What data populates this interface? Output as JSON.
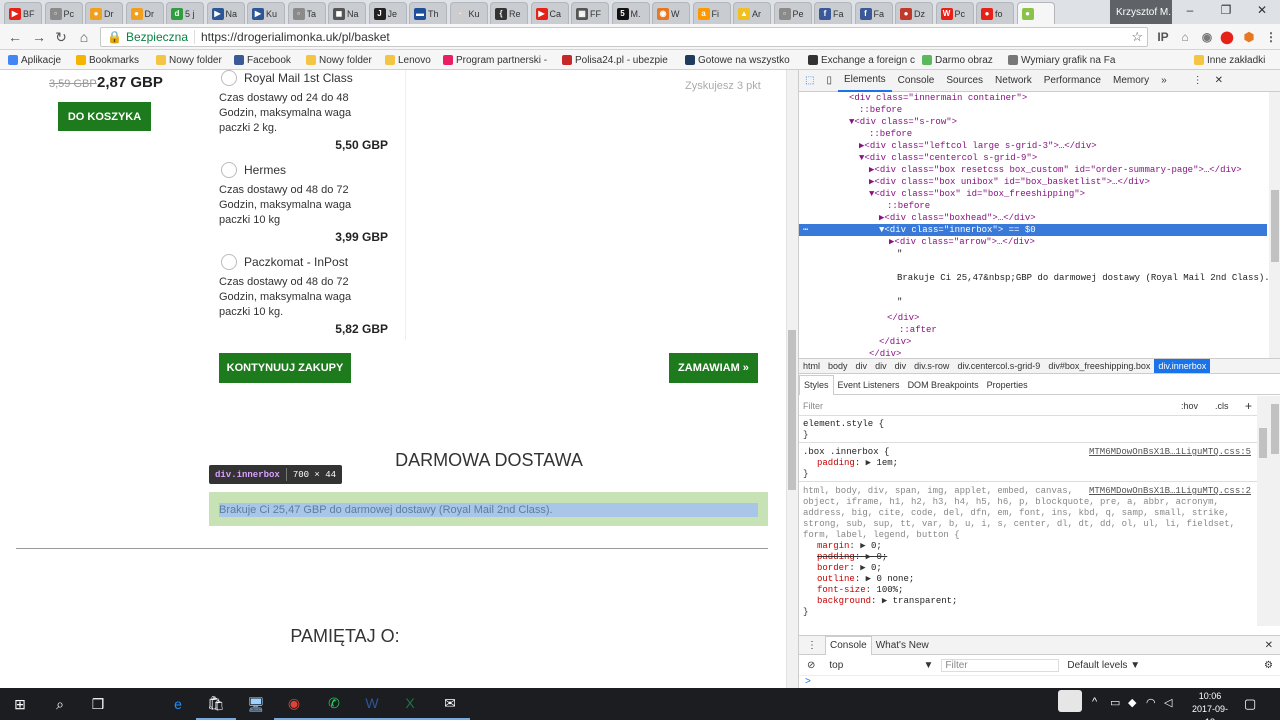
{
  "browser": {
    "tabs": [
      {
        "label": "BF",
        "color": "#e62117",
        "glyph": "▶"
      },
      {
        "label": "Pc",
        "color": "#8a8a8a",
        "glyph": "▫"
      },
      {
        "label": "Dr",
        "color": "#f0a020",
        "glyph": "●"
      },
      {
        "label": "Dr",
        "color": "#f0a020",
        "glyph": "●"
      },
      {
        "label": "5 j",
        "color": "#2e9e3e",
        "glyph": "d"
      },
      {
        "label": "Na",
        "color": "#2b5797",
        "glyph": "▶"
      },
      {
        "label": "Ku",
        "color": "#2b5797",
        "glyph": "▶"
      },
      {
        "label": "Ta",
        "color": "#8a8a8a",
        "glyph": "▫"
      },
      {
        "label": "Na",
        "color": "#555555",
        "glyph": "◼"
      },
      {
        "label": "Je",
        "color": "#222222",
        "glyph": "J"
      },
      {
        "label": "Th",
        "color": "#1f4e9c",
        "glyph": "▬"
      },
      {
        "label": "Ku",
        "color": "#cccccc",
        "glyph": "·"
      },
      {
        "label": "Re",
        "color": "#333333",
        "glyph": "{"
      },
      {
        "label": "Ca",
        "color": "#e62117",
        "glyph": "▶"
      },
      {
        "label": "FF",
        "color": "#555555",
        "glyph": "▦"
      },
      {
        "label": "M.",
        "color": "#111111",
        "glyph": "5"
      },
      {
        "label": "W",
        "color": "#e87722",
        "glyph": "◉"
      },
      {
        "label": "Fi",
        "color": "#ff9900",
        "glyph": "a"
      },
      {
        "label": "Ar",
        "color": "#f0c020",
        "glyph": "▲"
      },
      {
        "label": "Pe",
        "color": "#8a8a8a",
        "glyph": "▫"
      },
      {
        "label": "Fa",
        "color": "#3b5998",
        "glyph": "f"
      },
      {
        "label": "Fa",
        "color": "#3b5998",
        "glyph": "f"
      },
      {
        "label": "Dz",
        "color": "#c0392b",
        "glyph": "●"
      },
      {
        "label": "Pc",
        "color": "#e62117",
        "glyph": "W"
      },
      {
        "label": "fo",
        "color": "#e62117",
        "glyph": "●"
      },
      {
        "label": "",
        "color": "#8bc34a",
        "glyph": "●"
      }
    ],
    "profile_name": "Krzysztof M.",
    "window_buttons": [
      "–",
      "❐",
      "✕"
    ],
    "secure_label": "Bezpieczna",
    "url": "https://drogerialimonka.uk/pl/basket",
    "extensions": [
      "IP",
      "⌂",
      "◉",
      "⬤",
      "⬢"
    ],
    "bookmarks": [
      {
        "label": "Aplikacje",
        "color": "#4285f4"
      },
      {
        "label": "Bookmarks",
        "color": "#f4b400"
      },
      {
        "label": "Nowy folder",
        "color": "#f4c542"
      },
      {
        "label": "Facebook",
        "color": "#3b5998"
      },
      {
        "label": "Nowy folder",
        "color": "#f4c542"
      },
      {
        "label": "Lenovo",
        "color": "#f4c542"
      },
      {
        "label": "Program partnerski -",
        "color": "#e91e63"
      },
      {
        "label": "Polisa24.pl - ubezpie",
        "color": "#c62828"
      },
      {
        "label": "Gotowe na wszystko",
        "color": "#1e3a5f"
      },
      {
        "label": "Exchange a foreign c",
        "color": "#333333"
      },
      {
        "label": "Darmo obraz",
        "color": "#5cb85c"
      },
      {
        "label": "Wymiary grafik na Fa",
        "color": "#777777"
      },
      {
        "label": "Inne zakładki",
        "color": "#f4c542"
      }
    ]
  },
  "page": {
    "old_price": "3,59 GBP",
    "price": "2,87 GBP",
    "add_to_cart": "DO KOSZYKA",
    "points_text": "Zyskujesz 3 pkt",
    "shipping": [
      {
        "name": "Royal Mail 1st Class",
        "desc": [
          "Czas dostawy od 24 do 48",
          "Godzin, maksymalna waga",
          "paczki 2 kg."
        ],
        "price": "5,50 GBP"
      },
      {
        "name": "Hermes",
        "desc": [
          "Czas dostawy od 48 do 72",
          "Godzin, maksymalna waga",
          "paczki 10 kg"
        ],
        "price": "3,99 GBP"
      },
      {
        "name": "Paczkomat - InPost",
        "desc": [
          "Czas dostawy od 48 do 72",
          "Godzin, maksymalna waga",
          "paczki 10 kg."
        ],
        "price": "5,82 GBP"
      }
    ],
    "continue_button": "KONTYNUUJ ZAKUPY",
    "order_button": "ZAMAWIAM »",
    "free_delivery_title": "DARMOWA DOSTAWA",
    "free_delivery_text": "Brakuje Ci 25,47 GBP do darmowej dostawy (Royal Mail 2nd Class).",
    "inspect_tooltip": {
      "name": "div.innerbox",
      "size": "700 × 44"
    },
    "remember_title": "PAMIĘTAJ O:"
  },
  "devtools": {
    "tabs": [
      "Elements",
      "Console",
      "Sources",
      "Network",
      "Performance",
      "Memory",
      "»"
    ],
    "dom_lines": [
      "<div class=\"innermain container\">",
      "::before",
      "▼<div class=\"s-row\">",
      "::before",
      "▶<div class=\"leftcol large s-grid-3\">…</div>",
      "▼<div class=\"centercol s-grid-9\">",
      "▶<div class=\"box resetcss box_custom\" id=\"order-summary-page\">…</div>",
      "▶<div class=\"box unibox\" id=\"box_basketlist\">…</div>",
      "▼<div class=\"box\" id=\"box_freeshipping\">",
      "::before",
      "▶<div class=\"boxhead\">…</div>",
      "▼<div class=\"innerbox\"> == $0",
      "▶<div class=\"arrow\">…</div>",
      "\"",
      "",
      "Brakuje Ci 25,47&nbsp;GBP do darmowej dostawy (Royal Mail 2nd Class).",
      "",
      "\"",
      "</div>",
      "::after",
      "</div>",
      "</div>",
      "::after"
    ],
    "breadcrumbs": [
      "html",
      "body",
      "div",
      "div",
      "div",
      "div.s-row",
      "div.centercol.s-grid-9",
      "div#box_freeshipping.box",
      "div.innerbox"
    ],
    "subtabs": [
      "Styles",
      "Event Listeners",
      "DOM Breakpoints",
      "Properties"
    ],
    "filter_placeholder": "Filter",
    "filter_hov": ":hov",
    "filter_cls": ".cls",
    "filter_plus": "+",
    "styles": {
      "element_style": "element.style {",
      "close": "}",
      "rule1_selector": ".box .innerbox {",
      "rule1_source": "MTM6MDowOnBsX1B…1LiguMTQ.css:5",
      "rule1_prop": "padding",
      "rule1_value": "1em;",
      "rule2_source": "MTM6MDowOnBsX1B…1LiguMTQ.css:2",
      "rule2_selector_lines": [
        "html, body, div, span, img, applet, embed, canvas,",
        "object, iframe, h1, h2, h3, h4, h5, h6, p, blockquote, pre, a, abbr, acronym,",
        "address, big, cite, code, del, dfn, em, font, ins, kbd, q, samp, small, strike,",
        "strong, sub, sup, tt, var, b, u, i, s, center, dl, dt, dd, ol, ul, li, fieldset,",
        "form, label, legend, button {"
      ],
      "rule2_props": [
        {
          "name": "margin",
          "value": "0;"
        },
        {
          "name": "padding",
          "value": "0;"
        },
        {
          "name": "border",
          "value": "0;"
        },
        {
          "name": "outline",
          "value": "0 none;"
        },
        {
          "name": "font-size",
          "value": "100%;"
        },
        {
          "name": "background",
          "value": "transparent;"
        }
      ]
    },
    "drawer_tabs": [
      "Console",
      "What's New"
    ],
    "context": "top",
    "console_filter": "Filter",
    "levels": "Default levels ▼",
    "prompt": ">"
  },
  "taskbar": {
    "time": "10:06",
    "date": "2017-09-18",
    "apps": [
      "⊞",
      "⌕",
      "❒",
      "e",
      "🛍",
      "🖥",
      "◉",
      "✆",
      "W",
      "X",
      "✉"
    ]
  }
}
